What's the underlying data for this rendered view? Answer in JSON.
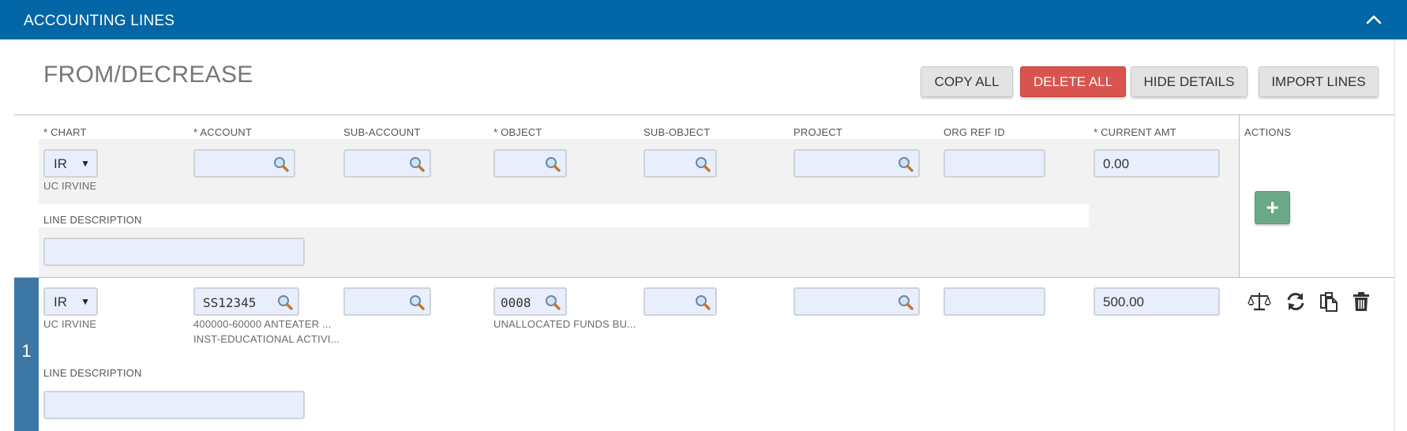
{
  "header": {
    "title": "ACCOUNTING LINES",
    "collapse_icon": "chevron-up-icon"
  },
  "section": {
    "title": "FROM/DECREASE"
  },
  "buttons": {
    "copy_all": "COPY ALL",
    "delete_all": "DELETE ALL",
    "hide_details": "HIDE DETAILS",
    "import_lines": "IMPORT LINES"
  },
  "columns": {
    "chart": "* CHART",
    "account": "* ACCOUNT",
    "sub_account": "SUB-ACCOUNT",
    "object": "* OBJECT",
    "sub_object": "SUB-OBJECT",
    "project": "PROJECT",
    "org_ref_id": "ORG REF ID",
    "current_amt": "* CURRENT AMT",
    "actions": "ACTIONS"
  },
  "new_line": {
    "chart": "IR",
    "chart_name": "UC IRVINE",
    "account": "",
    "sub_account": "",
    "object": "",
    "sub_object": "",
    "project": "",
    "org_ref_id": "",
    "current_amt": "0.00",
    "line_description_label": "LINE DESCRIPTION",
    "line_description": "",
    "add_icon": "plus-icon"
  },
  "lines": [
    {
      "number": "1",
      "chart": "IR",
      "chart_name": "UC IRVINE",
      "account": "SS12345",
      "account_desc_1": "400000-60000 ANTEATER ...",
      "account_desc_2": "INST-EDUCATIONAL ACTIVI...",
      "sub_account": "",
      "object": "0008",
      "object_desc": "UNALLOCATED FUNDS BU...",
      "sub_object": "",
      "project": "",
      "org_ref_id": "",
      "current_amt": "500.00",
      "line_description_label": "LINE DESCRIPTION",
      "line_description": "",
      "action_icons": [
        "balance-icon",
        "refresh-icon",
        "copy-icon",
        "trash-icon"
      ]
    }
  ],
  "colors": {
    "header": "#0266a7",
    "delete": "#d9534f",
    "add": "#6aa886",
    "line_number": "#3c77a5",
    "field_bg": "#e8eefb"
  }
}
